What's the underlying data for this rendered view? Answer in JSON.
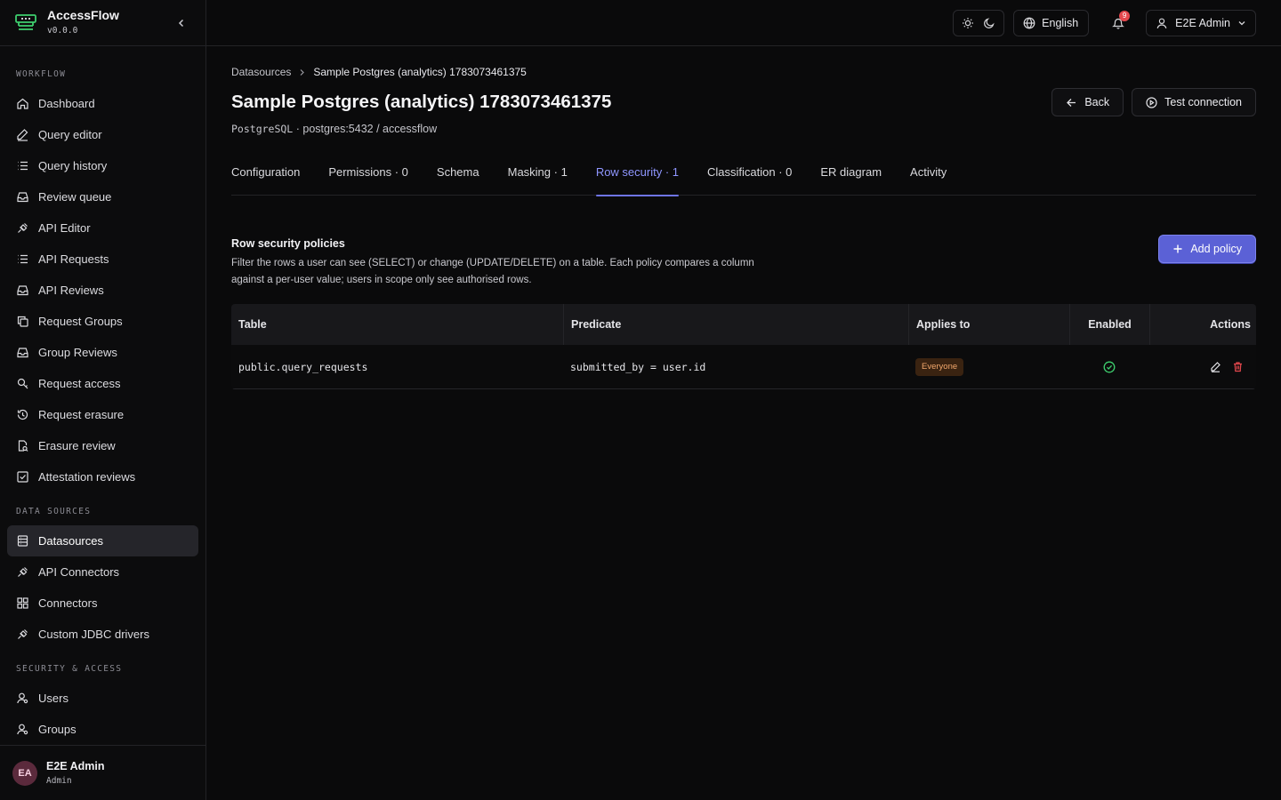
{
  "app": {
    "name": "AccessFlow",
    "version": "v0.0.0"
  },
  "sidebar": {
    "sections": [
      {
        "label": "WORKFLOW",
        "items": [
          {
            "label": "Dashboard",
            "icon": "home-icon"
          },
          {
            "label": "Query editor",
            "icon": "pencil-icon"
          },
          {
            "label": "Query history",
            "icon": "list-icon"
          },
          {
            "label": "Review queue",
            "icon": "inbox-icon"
          },
          {
            "label": "API Editor",
            "icon": "plug-icon"
          },
          {
            "label": "API Requests",
            "icon": "list-icon"
          },
          {
            "label": "API Reviews",
            "icon": "inbox-icon"
          },
          {
            "label": "Request Groups",
            "icon": "copy-icon"
          },
          {
            "label": "Group Reviews",
            "icon": "inbox-icon"
          },
          {
            "label": "Request access",
            "icon": "key-icon"
          },
          {
            "label": "Request erasure",
            "icon": "history-icon"
          },
          {
            "label": "Erasure review",
            "icon": "file-search-icon"
          },
          {
            "label": "Attestation reviews",
            "icon": "check-square-icon"
          }
        ]
      },
      {
        "label": "DATA SOURCES",
        "items": [
          {
            "label": "Datasources",
            "icon": "database-icon",
            "active": true
          },
          {
            "label": "API Connectors",
            "icon": "plug-icon"
          },
          {
            "label": "Connectors",
            "icon": "grid-icon"
          },
          {
            "label": "Custom JDBC drivers",
            "icon": "plug-icon"
          }
        ]
      },
      {
        "label": "SECURITY & ACCESS",
        "items": [
          {
            "label": "Users",
            "icon": "user-cog-icon"
          },
          {
            "label": "Groups",
            "icon": "user-cog-icon"
          }
        ]
      }
    ],
    "footer": {
      "initials": "EA",
      "name": "E2E Admin",
      "role": "Admin"
    }
  },
  "topbar": {
    "language": "English",
    "notifications": "9",
    "user": "E2E Admin"
  },
  "breadcrumb": {
    "root": "Datasources",
    "current": "Sample Postgres (analytics) 1783073461375"
  },
  "page": {
    "title": "Sample Postgres (analytics) 1783073461375",
    "engine": "PostgreSQL",
    "connection": "· postgres:5432 / accessflow",
    "back_label": "Back",
    "test_label": "Test connection"
  },
  "tabs": [
    {
      "label": "Configuration"
    },
    {
      "label": "Permissions · 0"
    },
    {
      "label": "Schema"
    },
    {
      "label": "Masking · 1"
    },
    {
      "label": "Row security · 1",
      "active": true
    },
    {
      "label": "Classification · 0"
    },
    {
      "label": "ER diagram"
    },
    {
      "label": "Activity"
    }
  ],
  "section": {
    "title": "Row security policies",
    "description": "Filter the rows a user can see (SELECT) or change (UPDATE/DELETE) on a table. Each policy compares a column against a per-user value; users in scope only see authorised rows.",
    "add_label": "Add policy"
  },
  "table": {
    "headers": {
      "table": "Table",
      "predicate": "Predicate",
      "applies": "Applies to",
      "enabled": "Enabled",
      "actions": "Actions"
    },
    "rows": [
      {
        "table": "public.query_requests",
        "predicate": "submitted_by = user.id",
        "applies": "Everyone",
        "enabled": true
      }
    ]
  },
  "colors": {
    "accent": "#6e74e8",
    "active_tab": "#8f96ff",
    "danger": "#e5484d",
    "success": "#3ecf6e",
    "badge_bg": "#3a2311",
    "badge_fg": "#f0a66b"
  }
}
